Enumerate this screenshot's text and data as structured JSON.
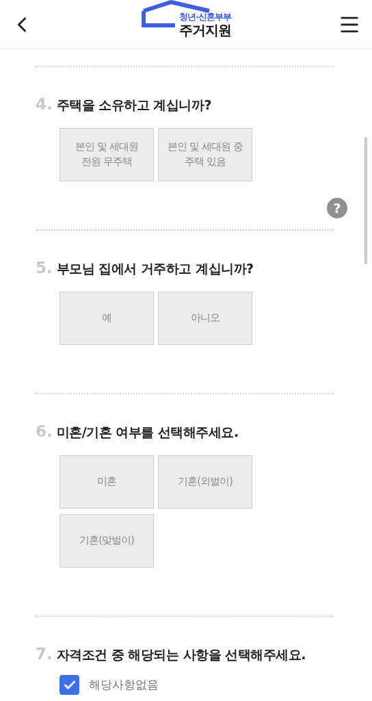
{
  "header": {
    "logo": {
      "tagline": "청년·신혼부부",
      "name": "주거지원"
    }
  },
  "questions": [
    {
      "number": "4.",
      "title": "주택을 소유하고 계십니까?",
      "kind": "choice",
      "help": "?",
      "options": [
        {
          "lines": [
            "본인 및 세대원",
            "전원 무주택"
          ],
          "selected": false
        },
        {
          "lines": [
            "본인 및 세대원 중",
            "주택 있음"
          ],
          "selected": false
        }
      ]
    },
    {
      "number": "5.",
      "title": "부모님 집에서 거주하고 계십니까?",
      "kind": "choice",
      "options": [
        {
          "lines": [
            "예"
          ],
          "selected": false
        },
        {
          "lines": [
            "아니오"
          ],
          "selected": false
        }
      ]
    },
    {
      "number": "6.",
      "title": "미혼/기혼 여부를 선택해주세요.",
      "kind": "choice",
      "options": [
        {
          "lines": [
            "미혼"
          ],
          "selected": false
        },
        {
          "lines": [
            "기혼(외벌이)"
          ],
          "selected": false
        },
        {
          "lines": [
            "기혼(맞벌이)"
          ],
          "selected": false
        }
      ]
    },
    {
      "number": "7.",
      "title": "자격조건 중 해당되는 사항을 선택해주세요.",
      "kind": "checklist",
      "options": [
        {
          "label": "해당사항없음",
          "checked": true
        }
      ]
    }
  ]
}
